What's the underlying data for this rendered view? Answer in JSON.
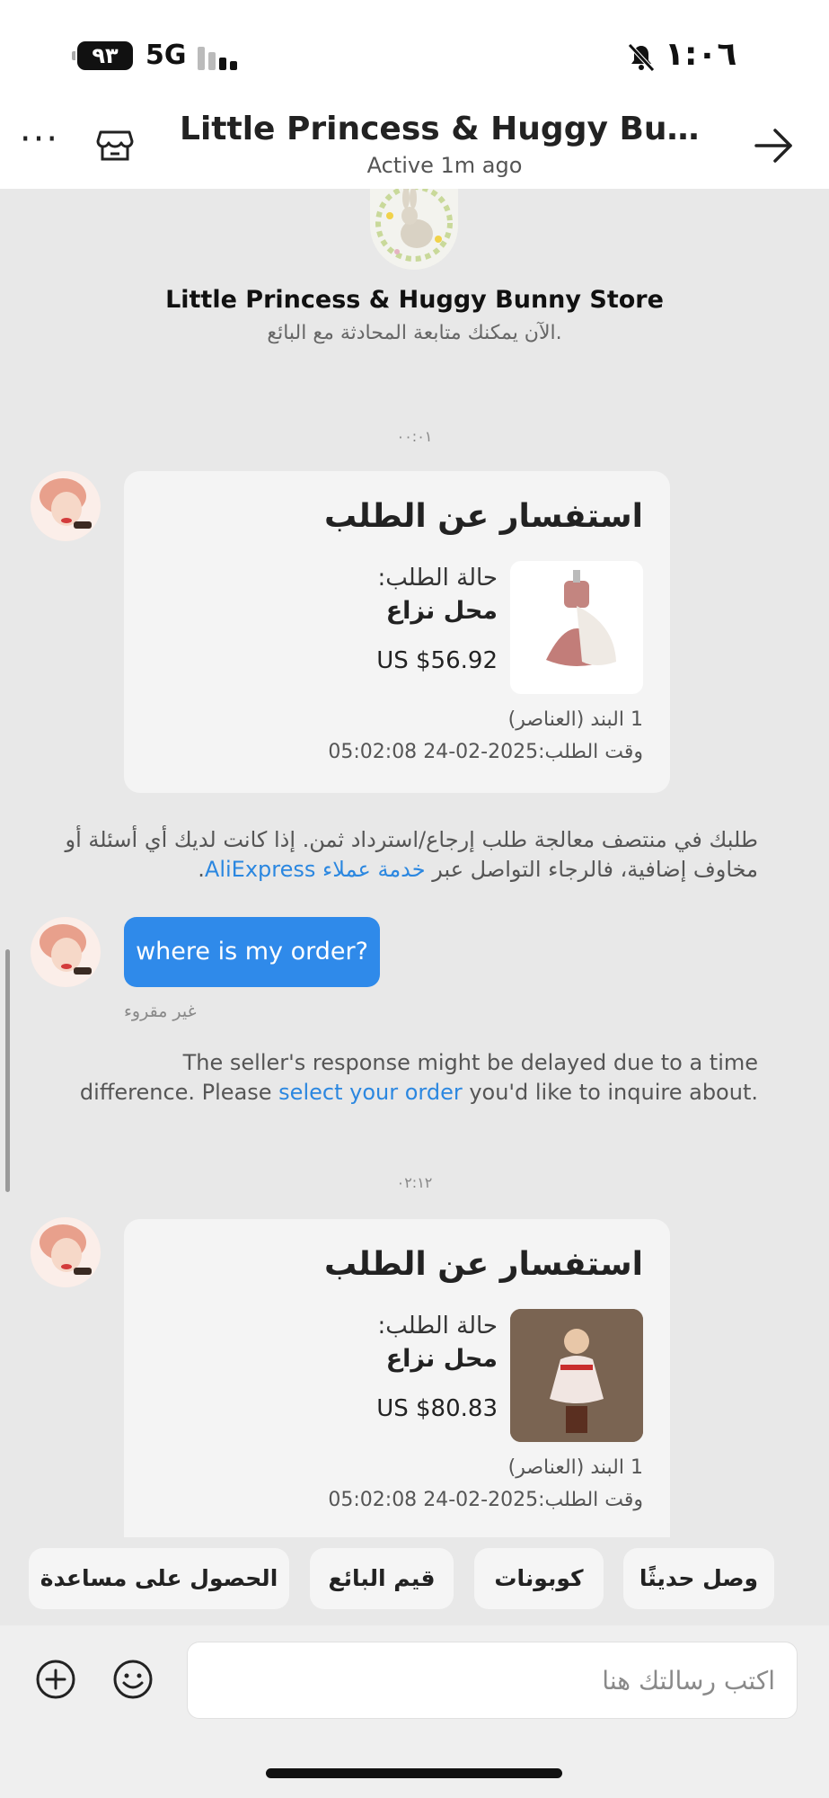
{
  "status_bar": {
    "battery": "٩٣",
    "network": "5G",
    "time": "١:٠٦"
  },
  "header": {
    "title": "Little Princess & Huggy Bunny S...",
    "subtitle": "Active 1m ago"
  },
  "store": {
    "name": "Little Princess & Huggy Bunny Store",
    "note": "الآن يمكنك متابعة المحادثة مع البائع."
  },
  "messages": {
    "timestamp_1": "٠٠:٠١",
    "timestamp_2": "٠٢:١٢",
    "card_1": {
      "title": "استفسار عن الطلب",
      "status_label": "حالة الطلب:",
      "status_value": "محل نزاع",
      "price": "US $56.92",
      "items": "1 البند (العناصر)",
      "order_time": "وقت الطلب:2025-02-24 05:02:08"
    },
    "card_2": {
      "title": "استفسار عن الطلب",
      "status_label": "حالة الطلب:",
      "status_value": "محل نزاع",
      "price": "US $80.83",
      "items": "1 البند (العناصر)",
      "order_time": "وقت الطلب:2025-02-24 05:02:08"
    },
    "refund_note_text": "طلبك في منتصف معالجة طلب إرجاع/استرداد ثمن. إذا كانت لديك أي أسئلة أو مخاوف إضافية، فالرجاء التواصل عبر ",
    "refund_note_link": "خدمة عملاء AliExpress",
    "refund_note_end": ".",
    "user_message": "where is my order?",
    "unread_label": "غير مقروء",
    "delay_note_text": "The seller's response might be delayed due to a time difference. Please ",
    "delay_note_link": "select your order",
    "delay_note_end": " you'd like to inquire about."
  },
  "quick_actions": [
    "وصل حديثًا",
    "كوبونات",
    "قيم البائع",
    "الحصول على مساعدة"
  ],
  "composer": {
    "placeholder": "اكتب رسالتك هنا"
  },
  "colors": {
    "accent": "#2f8aea",
    "link": "#2b87e0",
    "background": "#e8e8e8"
  },
  "icons": [
    "more-icon",
    "store-icon",
    "back-arrow-icon",
    "plus-icon",
    "emoji-icon",
    "mute-icon"
  ]
}
